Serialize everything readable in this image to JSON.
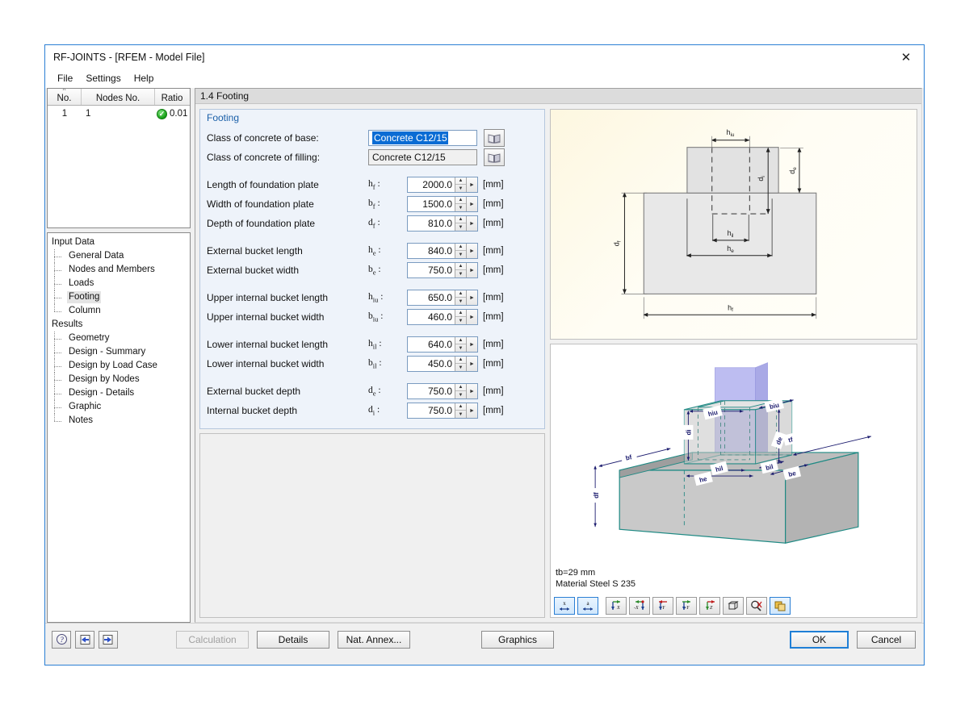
{
  "window": {
    "title": "RF-JOINTS - [RFEM - Model File]",
    "close_icon": "close-icon"
  },
  "menubar": {
    "items": [
      {
        "label": "File"
      },
      {
        "label": "Settings"
      },
      {
        "label": "Help"
      }
    ]
  },
  "nav_table": {
    "columns": [
      "No.",
      "Nodes No.",
      "Ratio"
    ],
    "sort_caret": "^",
    "rows": [
      {
        "no": "1",
        "nodes_no": "1",
        "ratio": "0.01",
        "status_icon": "check-circle-icon"
      }
    ]
  },
  "tree": {
    "groups": [
      {
        "label": "Input Data",
        "items": [
          {
            "label": "General Data",
            "selected": false
          },
          {
            "label": "Nodes and Members",
            "selected": false
          },
          {
            "label": "Loads",
            "selected": false
          },
          {
            "label": "Footing",
            "selected": true
          },
          {
            "label": "Column",
            "selected": false
          }
        ]
      },
      {
        "label": "Results",
        "items": [
          {
            "label": "Geometry",
            "selected": false
          },
          {
            "label": "Design - Summary",
            "selected": false
          },
          {
            "label": "Design by Load Case",
            "selected": false
          },
          {
            "label": "Design by Nodes",
            "selected": false
          },
          {
            "label": "Design - Details",
            "selected": false
          },
          {
            "label": "Graphic",
            "selected": false
          },
          {
            "label": "Notes",
            "selected": false
          }
        ]
      }
    ]
  },
  "section": {
    "header": "1.4 Footing",
    "group_title": "Footing"
  },
  "form": {
    "concrete_base": {
      "label": "Class of concrete of base:",
      "value": "Concrete C12/15",
      "selected": true,
      "button_icon": "book-icon"
    },
    "concrete_filling": {
      "label": "Class of concrete of filling:",
      "value": "Concrete C12/15",
      "selected": false,
      "button_icon": "book-icon"
    },
    "fields": [
      {
        "label": "Length of foundation plate",
        "sym": "h",
        "sub": "f",
        "value": "2000.0",
        "unit": "[mm]",
        "group": 1
      },
      {
        "label": "Width of foundation plate",
        "sym": "b",
        "sub": "f",
        "value": "1500.0",
        "unit": "[mm]",
        "group": 1
      },
      {
        "label": "Depth of foundation plate",
        "sym": "d",
        "sub": "f",
        "value": "810.0",
        "unit": "[mm]",
        "group": 1
      },
      {
        "label": "External bucket length",
        "sym": "h",
        "sub": "e",
        "value": "840.0",
        "unit": "[mm]",
        "group": 2
      },
      {
        "label": "External bucket width",
        "sym": "b",
        "sub": "e",
        "value": "750.0",
        "unit": "[mm]",
        "group": 2
      },
      {
        "label": "Upper internal bucket length",
        "sym": "h",
        "sub": "iu",
        "value": "650.0",
        "unit": "[mm]",
        "group": 3
      },
      {
        "label": "Upper internal bucket width",
        "sym": "b",
        "sub": "iu",
        "value": "460.0",
        "unit": "[mm]",
        "group": 3
      },
      {
        "label": "Lower internal bucket length",
        "sym": "h",
        "sub": "il",
        "value": "640.0",
        "unit": "[mm]",
        "group": 4
      },
      {
        "label": "Lower internal bucket width",
        "sym": "b",
        "sub": "il",
        "value": "450.0",
        "unit": "[mm]",
        "group": 4
      },
      {
        "label": "External bucket depth",
        "sym": "d",
        "sub": "e",
        "value": "750.0",
        "unit": "[mm]",
        "group": 5
      },
      {
        "label": "Internal bucket depth",
        "sym": "d",
        "sub": "i",
        "value": "750.0",
        "unit": "[mm]",
        "group": 5
      }
    ]
  },
  "drawing_2d": {
    "labels": [
      "h_iu",
      "d_e",
      "d_i",
      "d_f",
      "h_il",
      "h_e",
      "h_f"
    ],
    "label_hiu": "h",
    "label_hiu_sub": "iu",
    "label_de": "d",
    "label_de_sub": "e",
    "label_di": "d",
    "label_di_sub": "i",
    "label_df": "d",
    "label_df_sub": "f",
    "label_hil": "h",
    "label_hil_sub": "il",
    "label_he": "h",
    "label_he_sub": "e",
    "label_hf": "h",
    "label_hf_sub": "f"
  },
  "drawing_3d": {
    "labels": [
      "hiu",
      "biu",
      "di",
      "bf",
      "de",
      "tf",
      "hil",
      "bil",
      "be",
      "he",
      "df"
    ],
    "note_line1": "tb=29 mm",
    "note_line2": "Material Steel S 235"
  },
  "gfx_toolbar": {
    "buttons": [
      {
        "name": "show-dimension-x-button",
        "icon": "dimension-x-icon",
        "glyph": "x",
        "active": true
      },
      {
        "name": "show-dimension-a-button",
        "icon": "dimension-a-icon",
        "glyph": "a",
        "active": true
      },
      {
        "name": "view-x-button",
        "icon": "axis-x-icon",
        "glyph": "X",
        "active": false
      },
      {
        "name": "view-negx-button",
        "icon": "axis-neg-x-icon",
        "glyph": "-X",
        "active": false
      },
      {
        "name": "view-y-button",
        "icon": "axis-y-icon",
        "glyph": "Y",
        "active": false
      },
      {
        "name": "view-negy-button",
        "icon": "axis-neg-y-icon",
        "glyph": "-Y",
        "active": false
      },
      {
        "name": "view-z-button",
        "icon": "axis-z-icon",
        "glyph": "Z",
        "active": false
      },
      {
        "name": "isometric-view-button",
        "icon": "cube-icon",
        "glyph": "",
        "active": false
      },
      {
        "name": "zoom-reset-button",
        "icon": "magnifier-icon",
        "glyph": "",
        "active": false
      },
      {
        "name": "render-mode-button",
        "icon": "layers-icon",
        "glyph": "",
        "active": true
      }
    ]
  },
  "bottombar": {
    "help_icon": "help-icon",
    "prev_icon": "previous-arrow-icon",
    "next_icon": "next-arrow-icon",
    "calculation": "Calculation",
    "calculation_disabled": true,
    "details": "Details",
    "nat_annex": "Nat. Annex...",
    "graphics": "Graphics",
    "ok": "OK",
    "cancel": "Cancel"
  },
  "colors": {
    "accent": "#2b7fd4",
    "selection": "#0a6cd4",
    "group_title": "#1a5fa8",
    "status_ok": "#17a017",
    "drawing_2d_bg": "#fdf7e0",
    "model_edge": "#1f8a84",
    "column_purple": "#b0b0ee"
  }
}
